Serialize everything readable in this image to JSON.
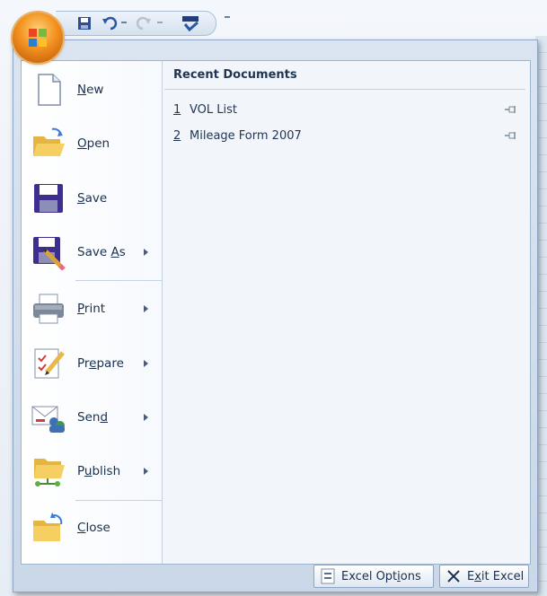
{
  "menu": {
    "items": [
      {
        "label_pre": "",
        "label_acc": "N",
        "label_post": "ew",
        "icon": "new-document-icon",
        "arrow": false
      },
      {
        "label_pre": "",
        "label_acc": "O",
        "label_post": "pen",
        "icon": "open-folder-icon",
        "arrow": false
      },
      {
        "label_pre": "",
        "label_acc": "S",
        "label_post": "ave",
        "icon": "save-disk-icon",
        "arrow": false
      },
      {
        "label_pre": "Save ",
        "label_acc": "A",
        "label_post": "s",
        "icon": "save-as-icon",
        "arrow": true
      },
      {
        "label_pre": "",
        "label_acc": "P",
        "label_post": "rint",
        "icon": "printer-icon",
        "arrow": true
      },
      {
        "label_pre": "Pr",
        "label_acc": "e",
        "label_post": "pare",
        "icon": "prepare-icon",
        "arrow": true
      },
      {
        "label_pre": "Sen",
        "label_acc": "d",
        "label_post": "",
        "icon": "send-icon",
        "arrow": true
      },
      {
        "label_pre": "P",
        "label_acc": "u",
        "label_post": "blish",
        "icon": "publish-icon",
        "arrow": true
      },
      {
        "label_pre": "",
        "label_acc": "C",
        "label_post": "lose",
        "icon": "close-folder-icon",
        "arrow": false
      }
    ]
  },
  "recent": {
    "title": "Recent Documents",
    "documents": [
      {
        "num": "1",
        "name": "VOL List"
      },
      {
        "num": "2",
        "name": "Mileage Form 2007"
      }
    ]
  },
  "footer": {
    "options_pre": "Excel Opt",
    "options_acc": "i",
    "options_post": "ons",
    "exit_pre": "E",
    "exit_acc": "x",
    "exit_post": "it Excel"
  },
  "colors": {
    "accent": "#f3921f",
    "frame": "#c9d7e8",
    "text": "#1a2f4d"
  }
}
